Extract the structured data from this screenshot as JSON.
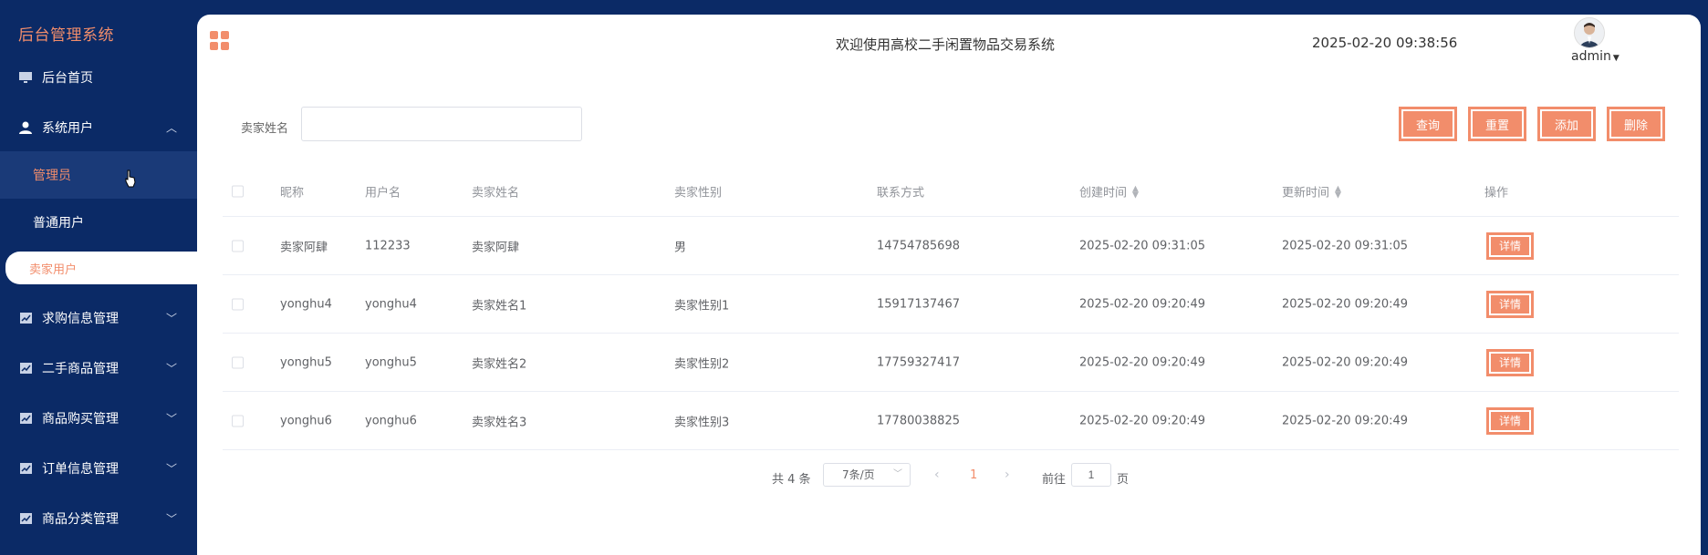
{
  "app": {
    "title": "后台管理系统",
    "welcome": "欢迎使用高校二手闲置物品交易系统",
    "datetime": "2025-02-20 09:38:56",
    "username": "admin",
    "accent": "#f28d6b",
    "sidebar_bg": "#0b2a66"
  },
  "sidebar": {
    "home": "后台首页",
    "system_users": "系统用户",
    "sub": {
      "admin": "管理员",
      "normal": "普通用户",
      "seller": "卖家用户"
    },
    "items": [
      {
        "label": "求购信息管理"
      },
      {
        "label": "二手商品管理"
      },
      {
        "label": "商品购买管理"
      },
      {
        "label": "订单信息管理"
      },
      {
        "label": "商品分类管理"
      }
    ]
  },
  "search": {
    "label": "卖家姓名",
    "value": ""
  },
  "toolbar": {
    "query": "查询",
    "reset": "重置",
    "add": "添加",
    "delete": "删除"
  },
  "table": {
    "headers": {
      "nickname": "昵称",
      "username": "用户名",
      "seller_name": "卖家姓名",
      "seller_gender": "卖家性别",
      "contact": "联系方式",
      "created": "创建时间",
      "updated": "更新时间",
      "action": "操作"
    },
    "detail_label": "详情",
    "rows": [
      {
        "nickname": "卖家阿肆",
        "username": "112233",
        "seller_name": "卖家阿肆",
        "seller_gender": "男",
        "contact": "14754785698",
        "created": "2025-02-20 09:31:05",
        "updated": "2025-02-20 09:31:05"
      },
      {
        "nickname": "yonghu4",
        "username": "yonghu4",
        "seller_name": "卖家姓名1",
        "seller_gender": "卖家性别1",
        "contact": "15917137467",
        "created": "2025-02-20 09:20:49",
        "updated": "2025-02-20 09:20:49"
      },
      {
        "nickname": "yonghu5",
        "username": "yonghu5",
        "seller_name": "卖家姓名2",
        "seller_gender": "卖家性别2",
        "contact": "17759327417",
        "created": "2025-02-20 09:20:49",
        "updated": "2025-02-20 09:20:49"
      },
      {
        "nickname": "yonghu6",
        "username": "yonghu6",
        "seller_name": "卖家姓名3",
        "seller_gender": "卖家性别3",
        "contact": "17780038825",
        "created": "2025-02-20 09:20:49",
        "updated": "2025-02-20 09:20:49"
      }
    ]
  },
  "pagination": {
    "total": "共 4 条",
    "page_size": "7条/页",
    "current": "1",
    "goto_label": "前往",
    "goto_value": "1",
    "page_unit": "页"
  }
}
